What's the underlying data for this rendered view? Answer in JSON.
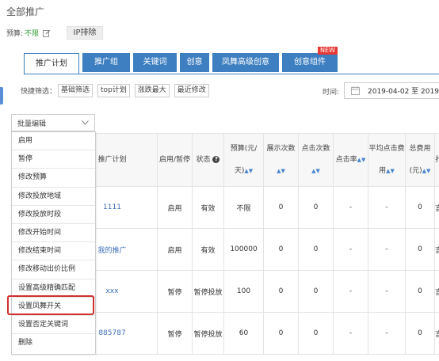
{
  "page_title": "全部推广",
  "budget": {
    "label": "预算:",
    "value": "不限"
  },
  "ip_exclude_label": "IP排除",
  "tabs": [
    {
      "label": "推广计划",
      "active": true
    },
    {
      "label": "推广组"
    },
    {
      "label": "关键词"
    },
    {
      "label": "创意"
    },
    {
      "label": "凤舞高级创意"
    },
    {
      "label": "创意组件",
      "badge": "NEW"
    }
  ],
  "quick_filter": {
    "label": "快捷筛选：",
    "buttons": [
      "基础筛选",
      "top计划",
      "涨跌最大",
      "最近修改"
    ]
  },
  "time": {
    "label": "时间:",
    "range": "2019-04-02 至 2019"
  },
  "bulk_edit": {
    "label": "批量编辑"
  },
  "dropdown_items": [
    "启用",
    "暂停",
    "修改预算",
    "修改投放地域",
    "修改投放时段",
    "修改开始时间",
    "修改结束时间",
    "修改移动出价比例",
    "设置高级精确匹配",
    "设置凤舞开关",
    "设置否定关键词",
    "删除"
  ],
  "highlighted_item": "设置凤舞开关",
  "table": {
    "headers": [
      {
        "label": "推广计划"
      },
      {
        "label": "启用/暂停"
      },
      {
        "label": "状态",
        "help": true
      },
      {
        "label": "预算(元/天)",
        "sort": true
      },
      {
        "label": "展示次数",
        "sort": true
      },
      {
        "label": "点击次数",
        "sort": true
      },
      {
        "label": "点击率",
        "sort": true
      },
      {
        "label": "平均点击费用",
        "sort": true
      },
      {
        "label": "总费用(元)",
        "sort": true
      },
      {
        "label": "扌"
      }
    ],
    "rows": [
      {
        "plan": "1111",
        "toggle": "启用",
        "status": "有效",
        "budget": "不限",
        "impressions": "0",
        "clicks": "0",
        "ctr": "-",
        "avg_cpc": "-",
        "cost": "0",
        "extra": "言"
      },
      {
        "plan": "我的推广",
        "toggle": "启用",
        "status": "有效",
        "budget": "100000",
        "impressions": "0",
        "clicks": "0",
        "ctr": "-",
        "avg_cpc": "-",
        "cost": "0",
        "extra": "言"
      },
      {
        "plan": "xxx",
        "toggle": "暂停",
        "status": "暂停投放",
        "budget": "100",
        "impressions": "0",
        "clicks": "0",
        "ctr": "-",
        "avg_cpc": "-",
        "cost": "0",
        "extra": "言"
      },
      {
        "plan": "885787",
        "toggle": "暂停",
        "status": "暂停投放",
        "budget": "60",
        "impressions": "0",
        "clicks": "0",
        "ctr": "-",
        "avg_cpc": "-",
        "cost": "0",
        "extra": "言"
      }
    ]
  },
  "colors": {
    "accent": "#3d7fc0",
    "budget_unlimited": "#2e9a2e",
    "highlight": "#d32f2f",
    "link": "#3d6fb8"
  }
}
